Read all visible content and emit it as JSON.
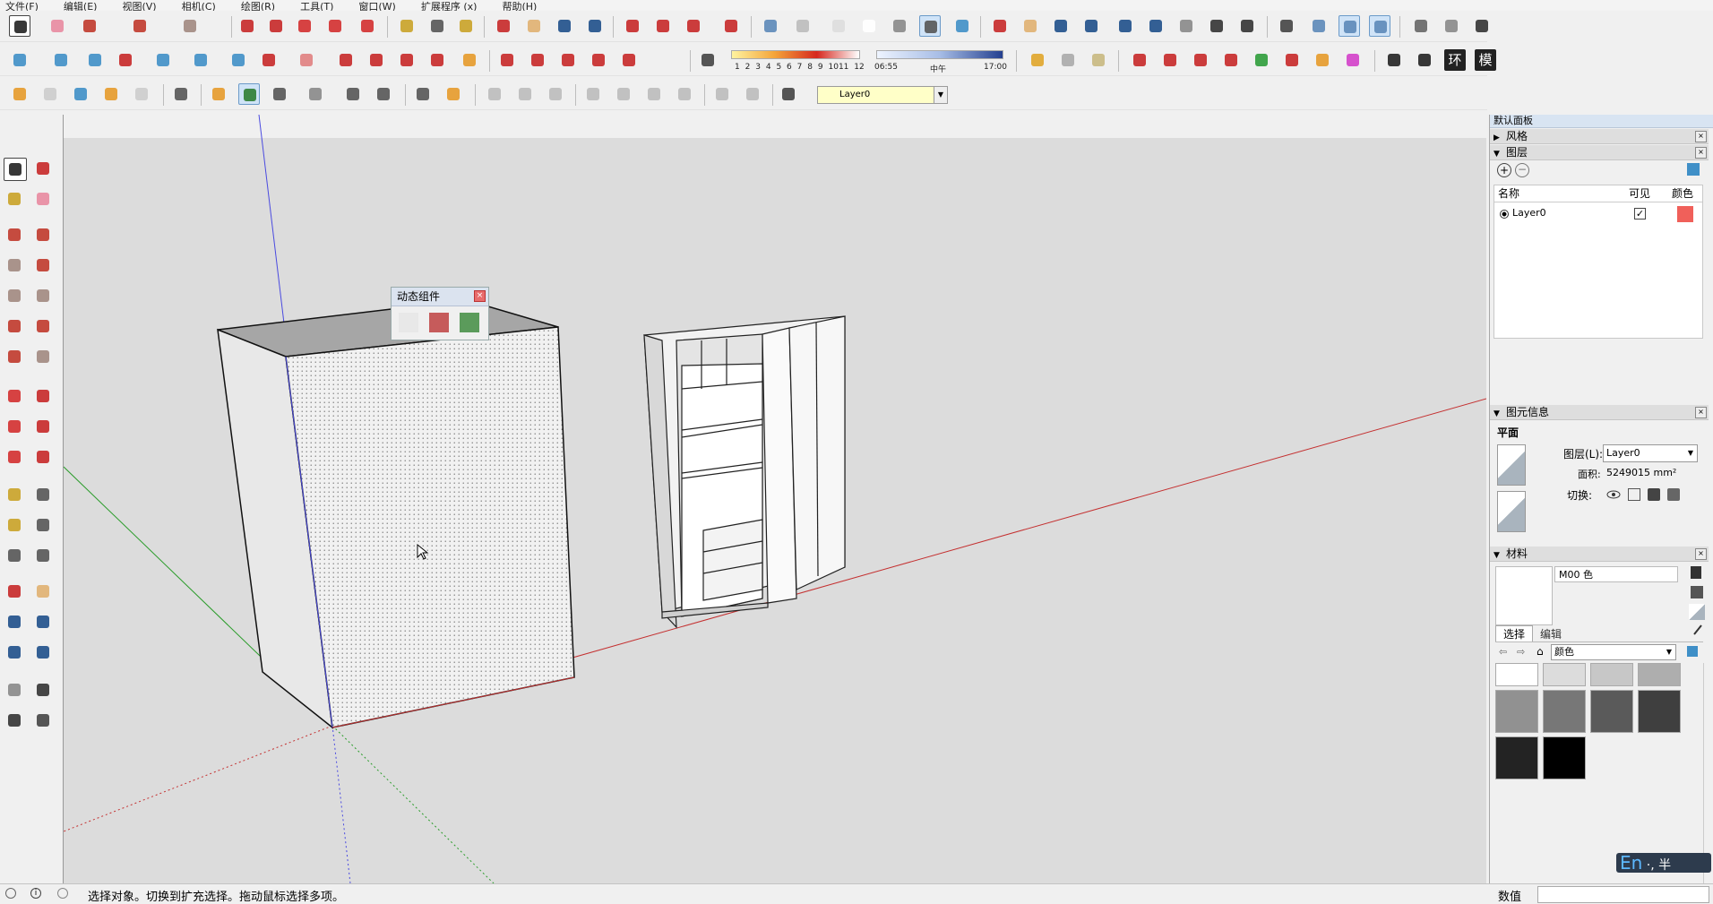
{
  "menu": [
    "文件(F)",
    "编辑(E)",
    "视图(V)",
    "相机(C)",
    "绘图(R)",
    "工具(T)",
    "窗口(W)",
    "扩展程序 (x)",
    "帮助(H)"
  ],
  "toolbar": {
    "time_ruler": [
      "1",
      "2",
      "3",
      "4",
      "5",
      "6",
      "7",
      "8",
      "9",
      "10",
      "11",
      "12"
    ],
    "time_start": "06:55",
    "time_mid": "中午",
    "time_end": "17:00",
    "text_buttons": [
      "环",
      "模"
    ],
    "layer_combo": "Layer0"
  },
  "dynamic_components": {
    "title": "动态组件"
  },
  "panel": {
    "title": "默认面板",
    "sections": {
      "style": "风格",
      "layers": "图层",
      "entity_info": "图元信息",
      "materials": "材料"
    },
    "layers": {
      "col_name": "名称",
      "col_visible": "可见",
      "col_color": "颜色",
      "rows": [
        {
          "name": "Layer0",
          "visible": true,
          "color": "#f0605a"
        }
      ]
    },
    "entity": {
      "type": "平面",
      "layer_label": "图层(L):",
      "layer_value": "Layer0",
      "area_label": "面积:",
      "area_value": "5249015 mm²",
      "toggle_label": "切换:"
    },
    "materials": {
      "name": "M00 色",
      "tab_select": "选择",
      "tab_edit": "编辑",
      "library": "颜色",
      "swatches": [
        "#ffffff",
        "#dcdcdc",
        "#c7c7c7",
        "#aeaeae",
        "#919191",
        "#777777",
        "#5a5a5a",
        "#3f3f3f",
        "#232323",
        "#000000"
      ]
    }
  },
  "status": {
    "message": "选择对象。切换到扩充选择。拖动鼠标选择多项。",
    "value_label": "数值"
  },
  "ime": {
    "lang": "En",
    "rest": "·, 半"
  }
}
